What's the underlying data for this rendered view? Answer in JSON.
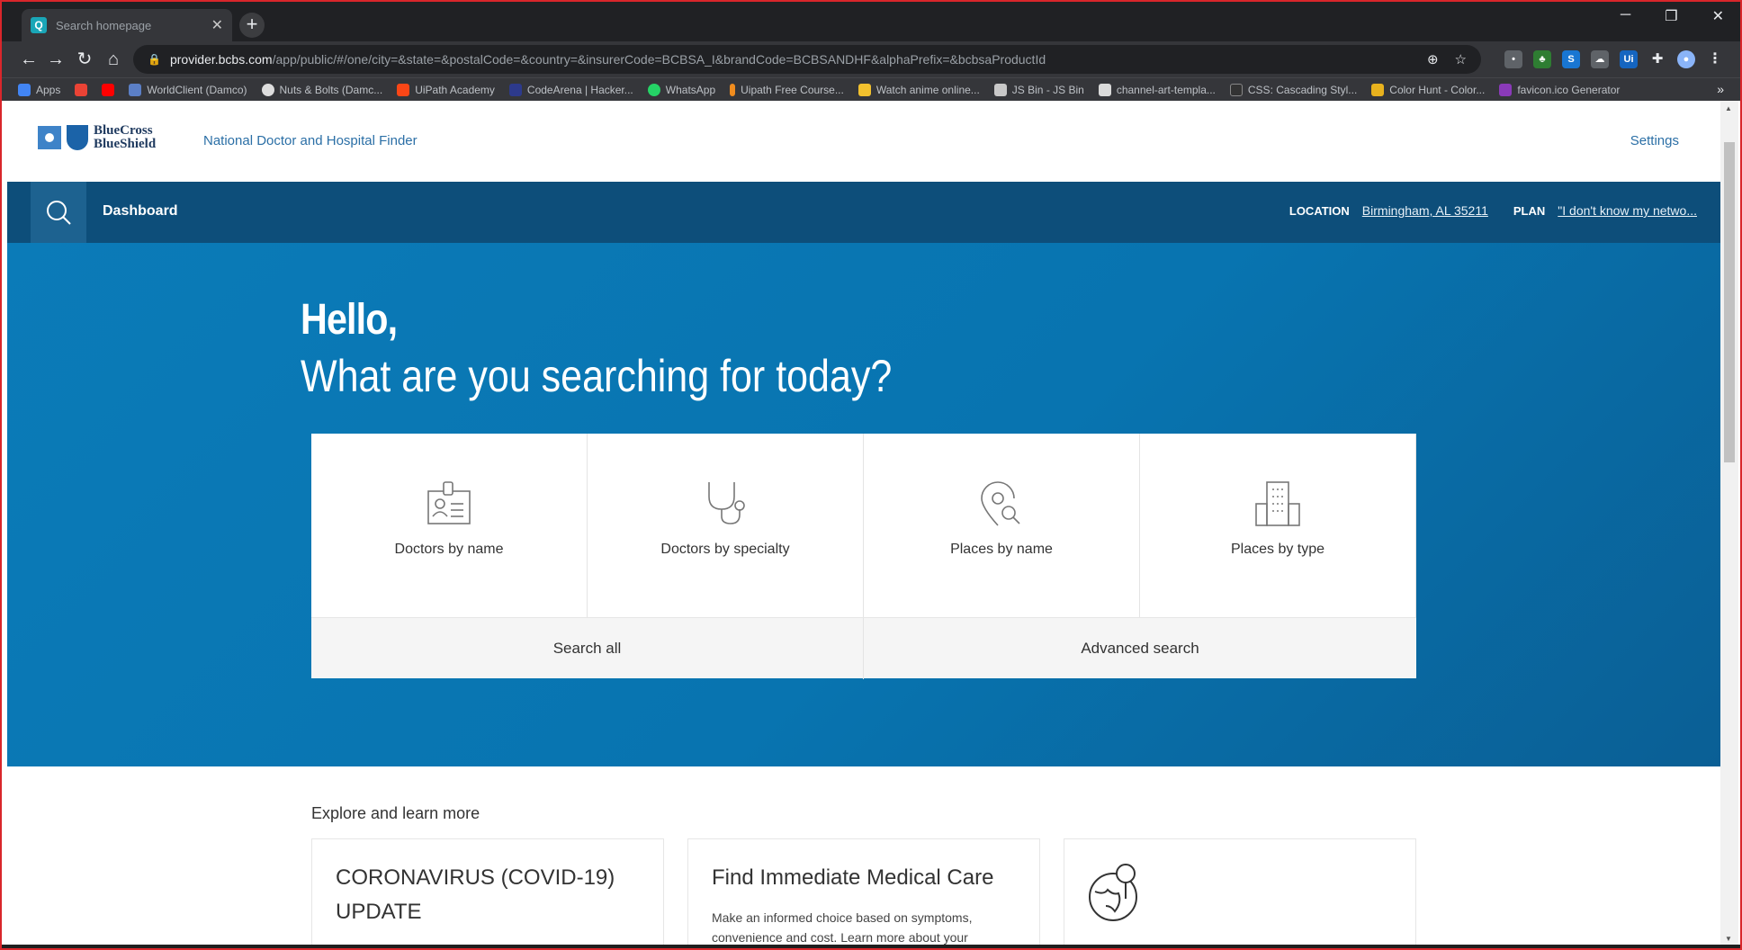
{
  "browser": {
    "tab_title": "Search homepage",
    "tab_favicon_letter": "Q",
    "url_host": "provider.bcbs.com",
    "url_rest": "/app/public/#/one/city=&state=&postalCode=&country=&insurerCode=BCBSA_I&brandCode=BCBSANDHF&alphaPrefix=&bcbsaProductId",
    "bookmarks": [
      {
        "label": "Apps",
        "color": "#4285f4"
      },
      {
        "label": "",
        "color": "#ea4335"
      },
      {
        "label": "",
        "color": "#ff0000"
      },
      {
        "label": "WorldClient (Damco)",
        "color": "#5b7fc6"
      },
      {
        "label": "Nuts & Bolts (Damc...",
        "color": "#dddddd"
      },
      {
        "label": "UiPath Academy",
        "color": "#fa4616"
      },
      {
        "label": "CodeArena | Hacker...",
        "color": "#2d3a8c"
      },
      {
        "label": "WhatsApp",
        "color": "#25d366"
      },
      {
        "label": "Uipath Free Course...",
        "color": "#f08c1e"
      },
      {
        "label": "Watch anime online...",
        "color": "#f2c12e"
      },
      {
        "label": "JS Bin - JS Bin",
        "color": "#c8c8c8"
      },
      {
        "label": "channel-art-templa...",
        "color": "#dadada"
      },
      {
        "label": "CSS: Cascading Styl...",
        "color": "#333333"
      },
      {
        "label": "Color Hunt - Color...",
        "color": "#e8b21e"
      },
      {
        "label": "favicon.ico Generator",
        "color": "#8a3ab9"
      }
    ]
  },
  "site": {
    "logo_line1": "BlueCross",
    "logo_line2": "BlueShield",
    "finder": "National Doctor and Hospital Finder",
    "settings": "Settings",
    "dashboard": "Dashboard",
    "location_label": "LOCATION",
    "location_value": "Birmingham, AL 35211",
    "plan_label": "PLAN",
    "plan_value": "\"I don't know my netwo..."
  },
  "hero": {
    "greeting": "Hello,",
    "question": "What are you searching for today?",
    "cards": [
      {
        "label": "Doctors by name",
        "icon": "id-card-icon"
      },
      {
        "label": "Doctors by specialty",
        "icon": "stethoscope-icon"
      },
      {
        "label": "Places by name",
        "icon": "map-pin-search-icon"
      },
      {
        "label": "Places by type",
        "icon": "building-icon"
      }
    ],
    "search_all": "Search all",
    "advanced_search": "Advanced search"
  },
  "explore": {
    "heading": "Explore and learn more",
    "tiles": [
      {
        "title": "CORONAVIRUS (COVID-19) UPDATE",
        "desc": ""
      },
      {
        "title": "Find Immediate Medical Care",
        "desc": "Make an informed choice based on symptoms, convenience and cost. Learn more about your"
      },
      {
        "title": "",
        "desc": "",
        "icon": "globe-pin-icon"
      }
    ]
  }
}
